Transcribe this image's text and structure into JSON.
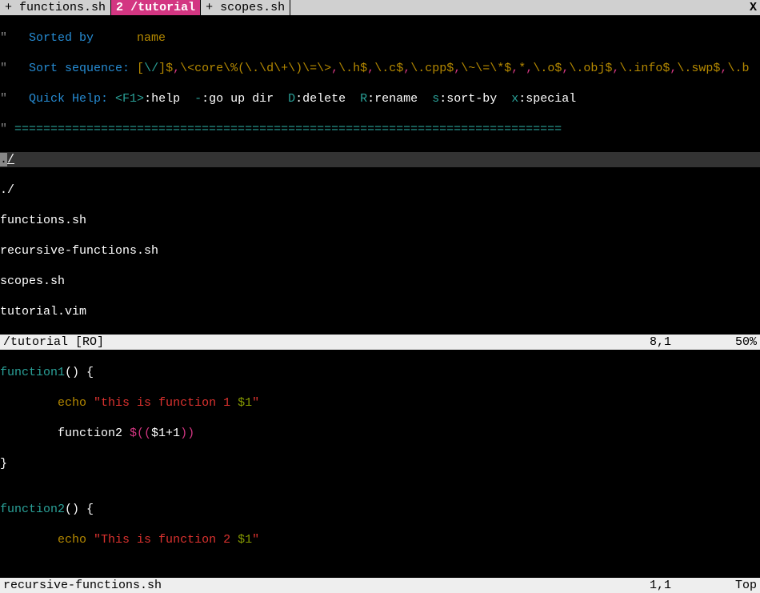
{
  "tabs": {
    "t1": "+ functions.sh",
    "t2n": "2",
    "t2": "/tutorial",
    "t3": "+ scopes.sh",
    "close": "X"
  },
  "header": {
    "q": "\"   ",
    "sorted_by": "Sorted by      ",
    "name": "name",
    "sort_seq": "Sort sequence: ",
    "seq_open": "[",
    "seq1": "\\/",
    "seq1b": "]$",
    "seq2": "\\<core\\%(\\.\\d\\+\\)\\=\\>",
    "seq3": "\\.h$",
    "seq4": "\\.c$",
    "seq5": "\\.cpp$",
    "seq6": "\\~\\=\\*$",
    "seq7": "*",
    "seq8": "\\.o$",
    "seq9": "\\.obj$",
    "seq10": "\\.info$",
    "seq11": "\\.swp$",
    "seq12": "\\.b",
    "comma": ",",
    "quick_help": "Quick Help: ",
    "f1": "<F1>",
    "help": ":help  ",
    "dash": "-",
    "goup": ":go up dir  ",
    "D": "D",
    "delete": ":delete  ",
    "R": "R",
    "rename": ":rename  ",
    "s": "s",
    "sortby": ":sort-by  ",
    "x": "x",
    "special": ":special",
    "equals": "============================================================================"
  },
  "cursor": {
    "dot": ".",
    "slash": "/"
  },
  "files": {
    "f0": "./",
    "f1": "functions.sh",
    "f2": "recursive-functions.sh",
    "f3": "scopes.sh",
    "f4": "tutorial.vim"
  },
  "status1": {
    "name": "/tutorial [RO]",
    "pos": "8,1",
    "pct": "50%"
  },
  "code": {
    "fn1": "function1",
    "paren": "() {",
    "indent": "        ",
    "echo": "echo",
    "sp": " ",
    "str1a": "\"this is function 1 ",
    "dollar1": "$1",
    "qend": "\"",
    "fn2call": "function2 ",
    "interp": "$((",
    "interp_in": "$1+1",
    "interp_end": "))",
    "brace": "}",
    "blank": "",
    "fn2": "function2",
    "str2a": "\"This is function 2 "
  },
  "status2": {
    "name": "recursive-functions.sh",
    "pos": "1,1",
    "pct": "Top"
  }
}
